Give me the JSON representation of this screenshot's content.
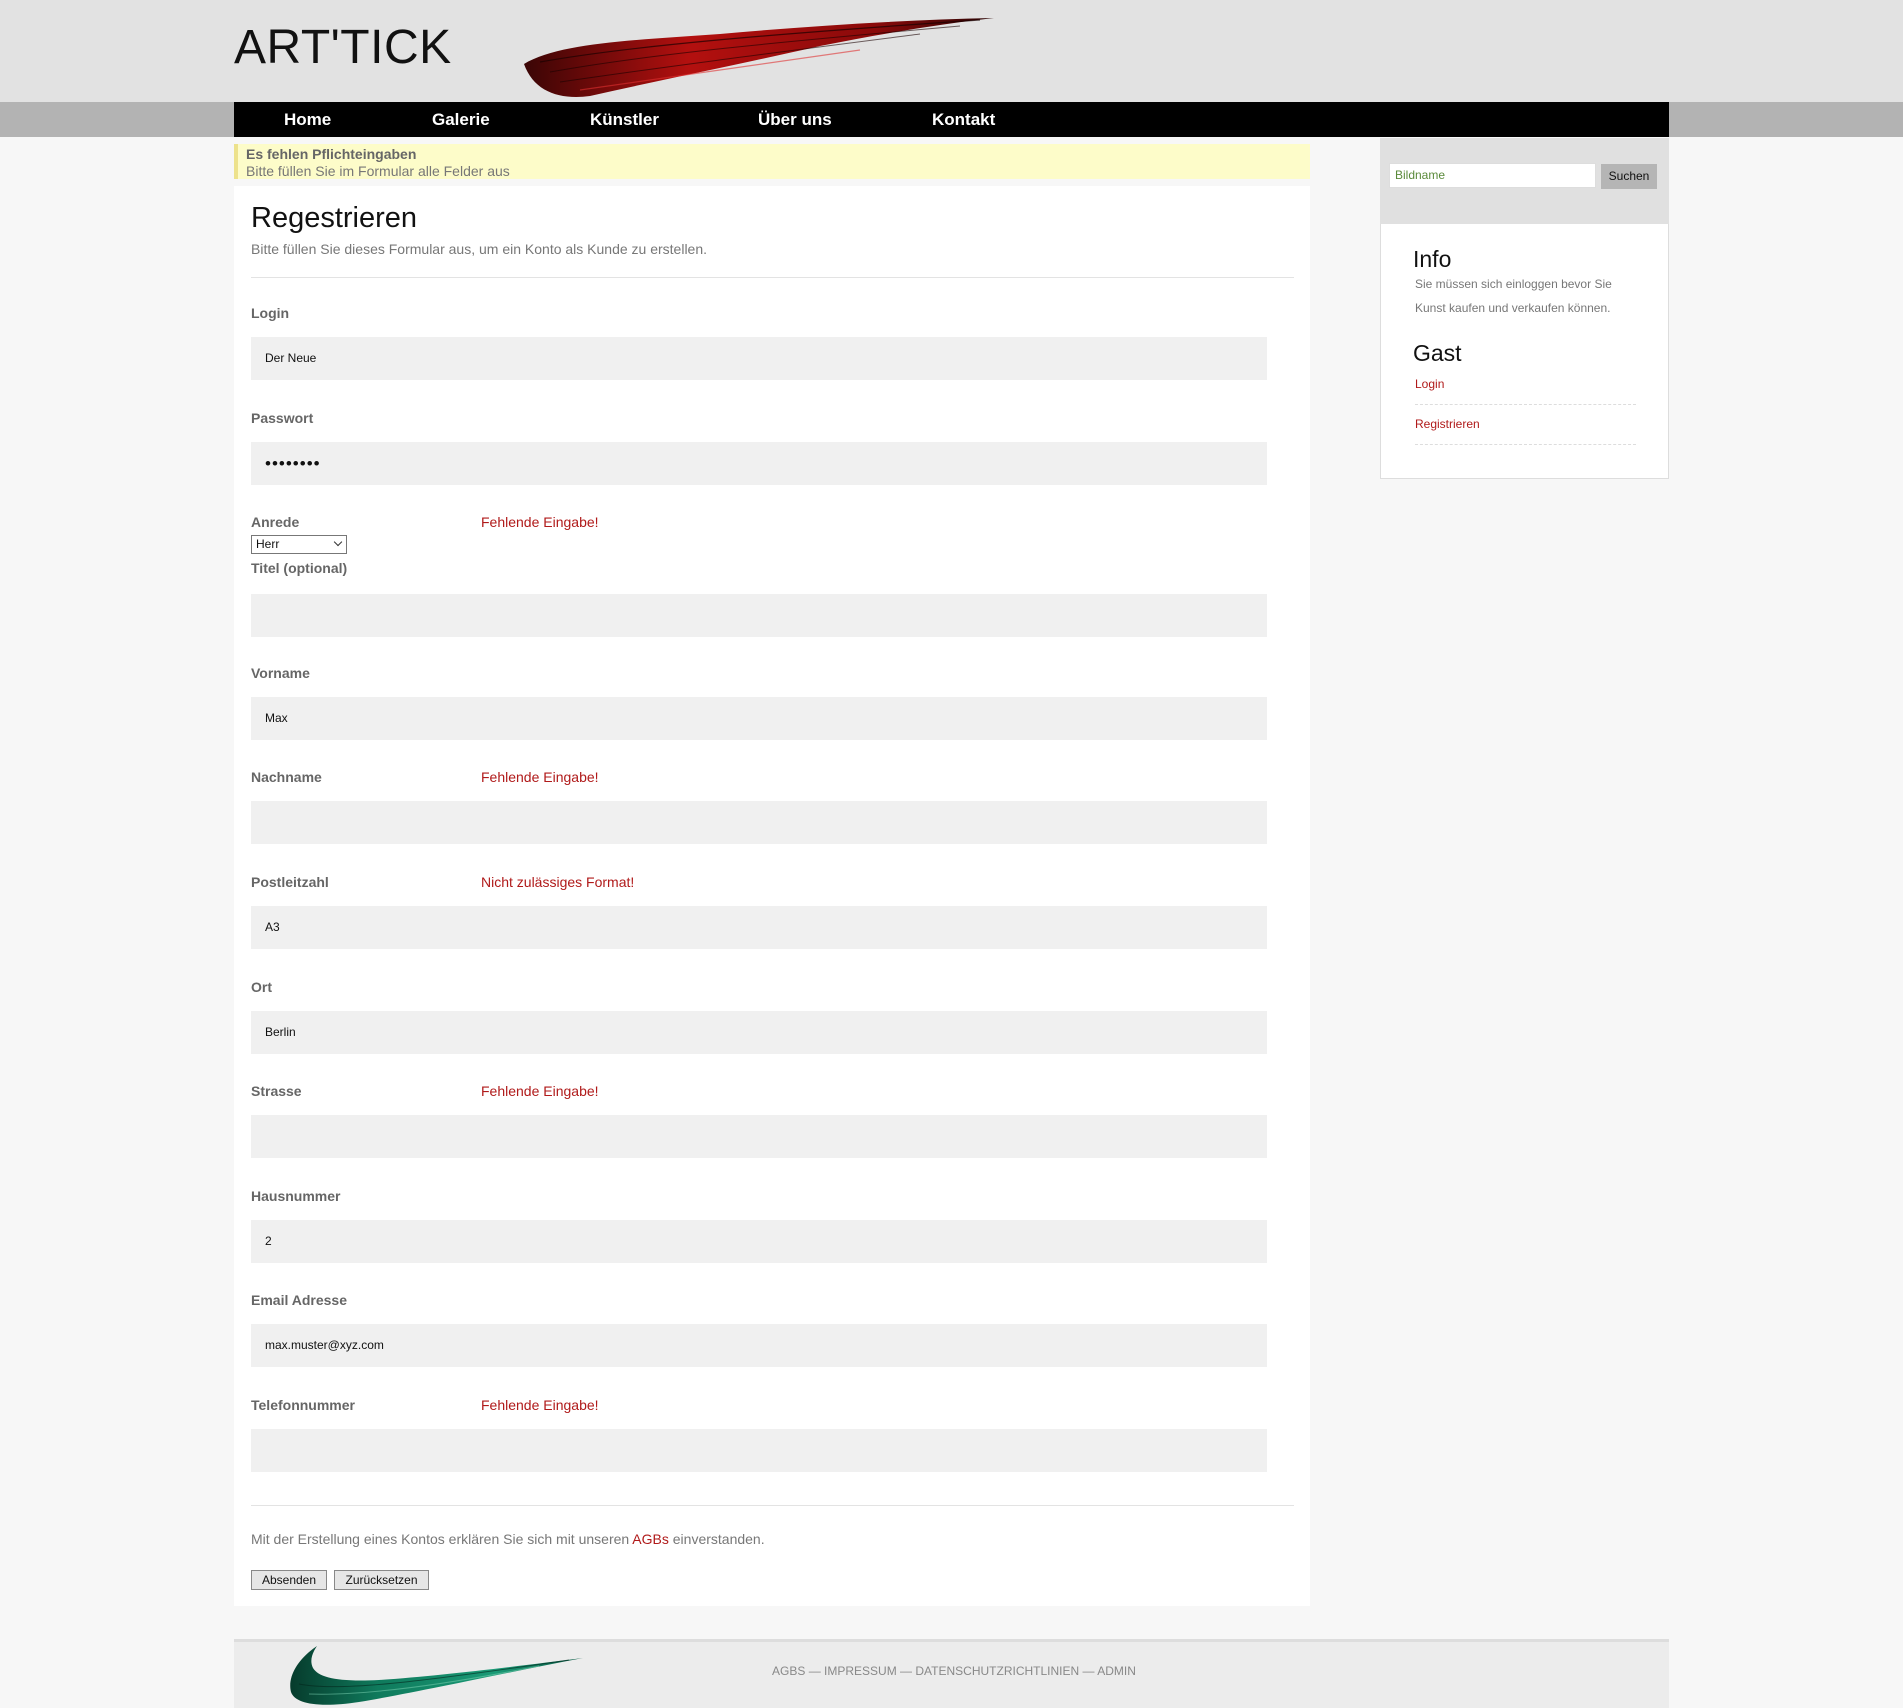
{
  "header": {
    "logo": "ART'TICK"
  },
  "nav": {
    "items": [
      "Home",
      "Galerie",
      "Künstler",
      "Über uns",
      "Kontakt"
    ]
  },
  "alert": {
    "title": "Es fehlen Pflichteingaben",
    "text": "Bitte füllen Sie im Formular alle Felder aus"
  },
  "form": {
    "title": "Regestrieren",
    "subtitle": "Bitte füllen Sie dieses Formular aus, um ein Konto als Kunde zu erstellen.",
    "login": {
      "label": "Login",
      "value": "Der Neue",
      "error": ""
    },
    "password": {
      "label": "Passwort",
      "value": "••••••••",
      "error": ""
    },
    "anrede": {
      "label": "Anrede",
      "value": "Herr",
      "error": "Fehlende Eingabe!"
    },
    "titel": {
      "label": "Titel (optional)",
      "value": "",
      "error": ""
    },
    "vorname": {
      "label": "Vorname",
      "value": "Max",
      "error": ""
    },
    "nachname": {
      "label": "Nachname",
      "value": "",
      "error": "Fehlende Eingabe!"
    },
    "plz": {
      "label": "Postleitzahl",
      "value": "A3",
      "error": "Nicht zulässiges Format!"
    },
    "ort": {
      "label": "Ort",
      "value": "Berlin",
      "error": ""
    },
    "strasse": {
      "label": "Strasse",
      "value": "",
      "error": "Fehlende Eingabe!"
    },
    "hausnummer": {
      "label": "Hausnummer",
      "value": "2",
      "error": ""
    },
    "email": {
      "label": "Email Adresse",
      "value": "max.muster@xyz.com",
      "error": ""
    },
    "telefon": {
      "label": "Telefonnummer",
      "value": "",
      "error": "Fehlende Eingabe!"
    },
    "terms_before": "Mit der Erstellung eines Kontos erklären Sie sich mit unseren ",
    "terms_link": "AGBs",
    "terms_after": " einverstanden.",
    "submit_label": "Absenden",
    "reset_label": "Zurücksetzen"
  },
  "sidebar": {
    "search_placeholder": "Bildname",
    "search_button": "Suchen",
    "info_title": "Info",
    "info_text": "Sie müssen sich einloggen bevor Sie Kunst kaufen und verkaufen können.",
    "guest_title": "Gast",
    "links": [
      "Login",
      "Registrieren"
    ]
  },
  "footer": {
    "links": [
      "AGBS",
      "IMPRESSUM",
      "DATENSCHUTZRICHTLINIEN",
      "ADMIN"
    ],
    "separator": " — "
  },
  "colors": {
    "nav_bg": "#000000",
    "error": "#b01a1a",
    "alert_bg": "#fdfcc9",
    "brush_red": "#b3100f",
    "brush_green": "#0f7a5c"
  }
}
